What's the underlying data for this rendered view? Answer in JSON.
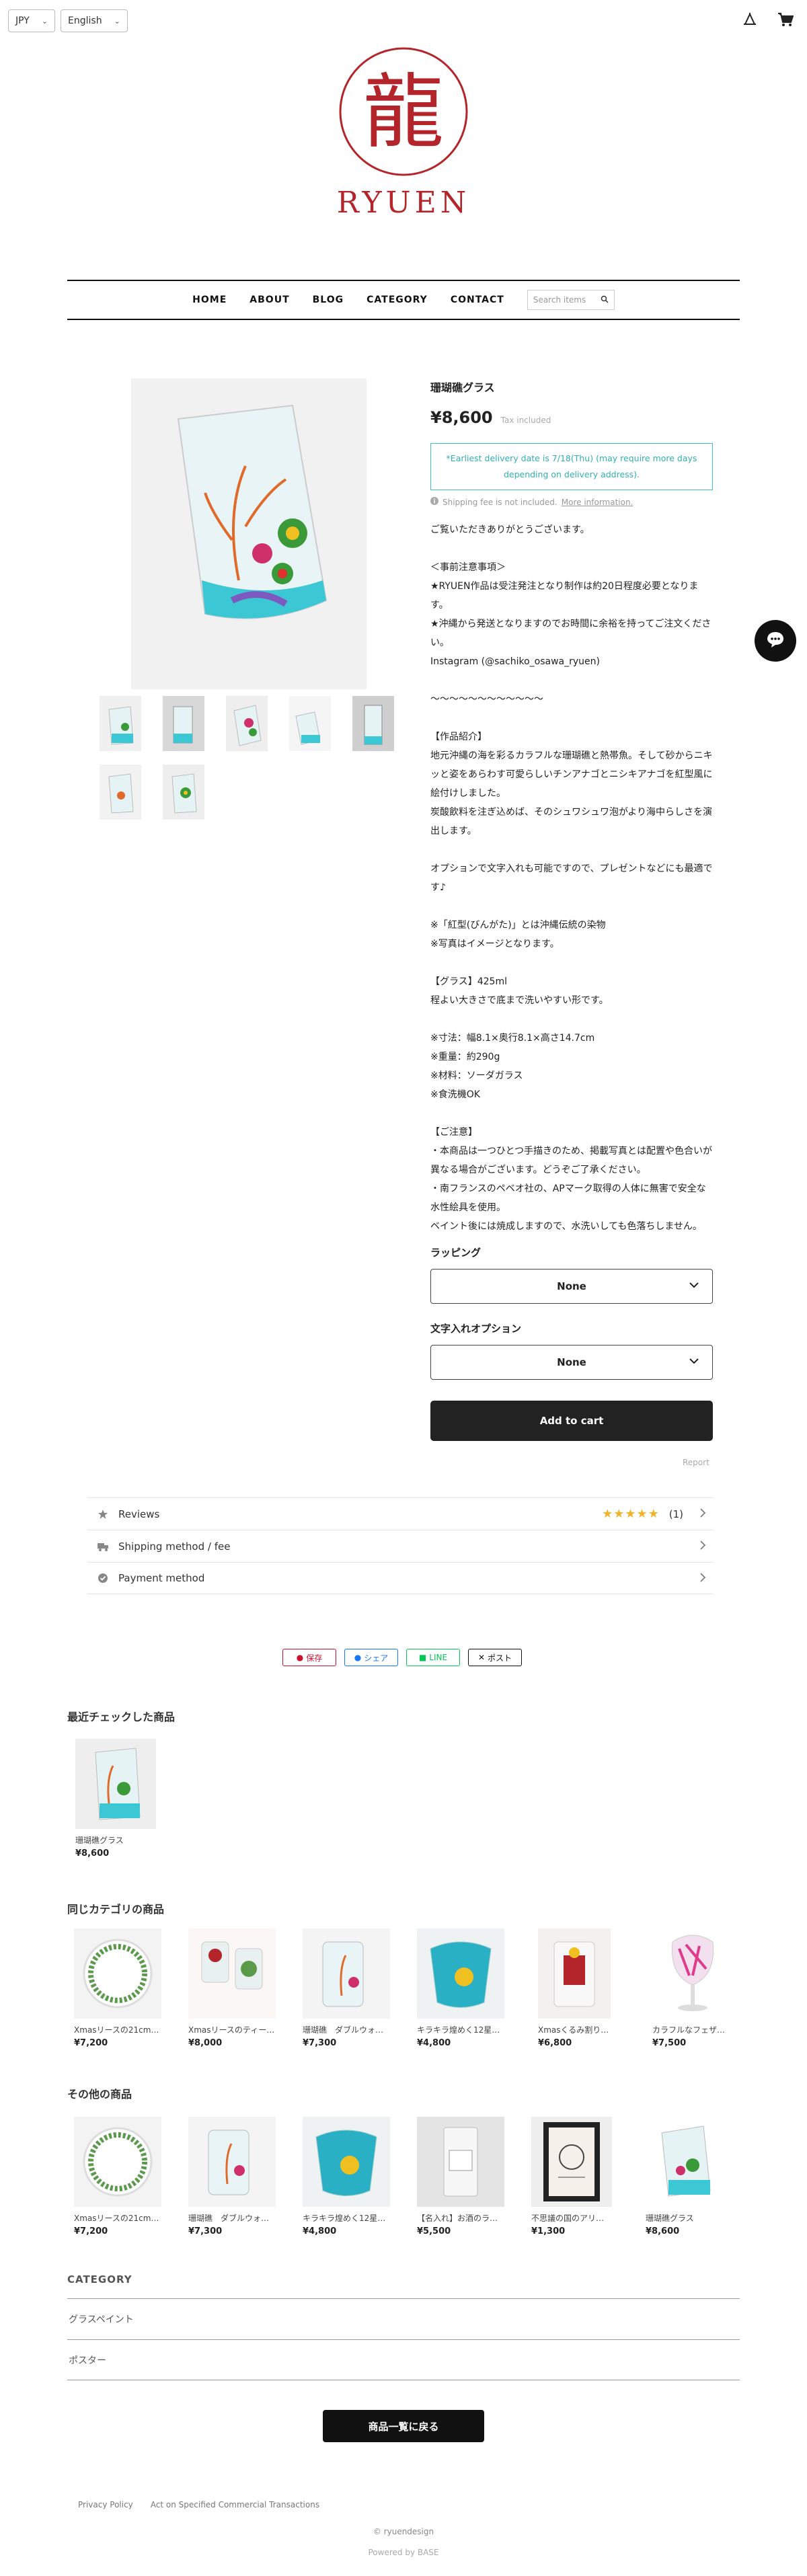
{
  "header": {
    "currency": "JPY",
    "language": "English",
    "logo_kanji": "龍",
    "logo_text": "RYUEN"
  },
  "nav": {
    "items": [
      "HOME",
      "ABOUT",
      "BLOG",
      "CATEGORY",
      "CONTACT"
    ],
    "search_placeholder": "Search items"
  },
  "product": {
    "title": "珊瑚礁グラス",
    "price": "¥8,600",
    "tax": "Tax included",
    "delivery": "*Earliest delivery date is 7/18(Thu) (may require more days depending on delivery address).",
    "ship_note": "Shipping fee is not included.",
    "ship_more": "More information.",
    "description": "ご覧いただきありがとうございます。\n\n＜事前注意事項＞\n★RYUEN作品は受注発注となり制作は約20日程度必要となります。\n★沖縄から発送となりますのでお時間に余裕を持ってご注文ください。\nInstagram (@sachiko_osawa_ryuen)\n\n〜〜〜〜〜〜〜〜〜〜〜〜\n\n【作品紹介】\n地元沖縄の海を彩るカラフルな珊瑚礁と熱帯魚。そして砂からニキッと姿をあらわす可愛らしいチンアナゴとニシキアナゴを紅型風に絵付けしました。\n炭酸飲料を注ぎ込めば、そのシュワシュワ泡がより海中らしさを演出します。\n\nオプションで文字入れも可能ですので、プレゼントなどにも最適です♪\n\n※「紅型(びんがた)」とは沖縄伝統の染物\n※写真はイメージとなります。\n\n【グラス】425ml\n程よい大きさで底まで洗いやすい形です。\n\n※寸法：幅8.1×奥行8.1×高さ14.7cm\n※重量：約290g\n※材料：ソーダガラス\n※食洗機OK\n\n【ご注意】\n・本商品は一つひとつ手描きのため、掲載写真とは配置や色合いが異なる場合がございます。どうぞご了承ください。\n・南フランスのペベオ社の、APマーク取得の人体に無害で安全な水性絵具を使用。\nベイント後には焼成しますので、水洗いしても色落ちしません。",
    "options": [
      {
        "label": "ラッピング",
        "value": "None"
      },
      {
        "label": "文字入れオプション",
        "value": "None"
      }
    ],
    "add_to_cart": "Add to cart",
    "report": "Report"
  },
  "accordion": {
    "reviews": "Reviews",
    "review_count": "(1)",
    "stars": "★★★★★",
    "shipping": "Shipping method / fee",
    "payment": "Payment method"
  },
  "share": {
    "pin": "保存",
    "facebook": "シェア",
    "line": "LINE",
    "x": "ポスト"
  },
  "recent": {
    "title": "最近チェックした商品",
    "items": [
      {
        "name": "珊瑚礁グラス",
        "price": "¥8,600"
      }
    ]
  },
  "same_category": {
    "title": "同じカテゴリの商品",
    "items": [
      {
        "name": "Xmasリースの21cm…",
        "price": "¥7,200"
      },
      {
        "name": "Xmasリースのティー…",
        "price": "¥8,000"
      },
      {
        "name": "珊瑚礁　ダブルウォー…",
        "price": "¥7,300"
      },
      {
        "name": "キラキラ煌めく12星座…",
        "price": "¥4,800"
      },
      {
        "name": "Xmasくるみ割り人形…",
        "price": "¥6,800"
      },
      {
        "name": "カラフルなフェザーが…",
        "price": "¥7,500"
      }
    ]
  },
  "other": {
    "title": "その他の商品",
    "items": [
      {
        "name": "Xmasリースの21cm…",
        "price": "¥7,200"
      },
      {
        "name": "珊瑚礁　ダブルウォー…",
        "price": "¥7,300"
      },
      {
        "name": "キラキラ煌めく12星座…",
        "price": "¥4,800"
      },
      {
        "name": "【名入れ】お酒のラベ…",
        "price": "¥5,500"
      },
      {
        "name": "不思議の国のアリスポ…",
        "price": "¥1,300"
      },
      {
        "name": "珊瑚礁グラス",
        "price": "¥8,600"
      }
    ]
  },
  "category": {
    "title": "CATEGORY",
    "items": [
      "グラスペイント",
      "ポスター"
    ]
  },
  "back_button": "商品一覧に戻る",
  "footer": {
    "privacy": "Privacy Policy",
    "act": "Act on Specified Commercial Transactions",
    "copyright": "© ryuendesign",
    "powered": "Powered by BASE"
  },
  "colors": {
    "brand_red": "#b3252a",
    "delivery_teal": "#30b0b0",
    "star": "#f2b424"
  }
}
